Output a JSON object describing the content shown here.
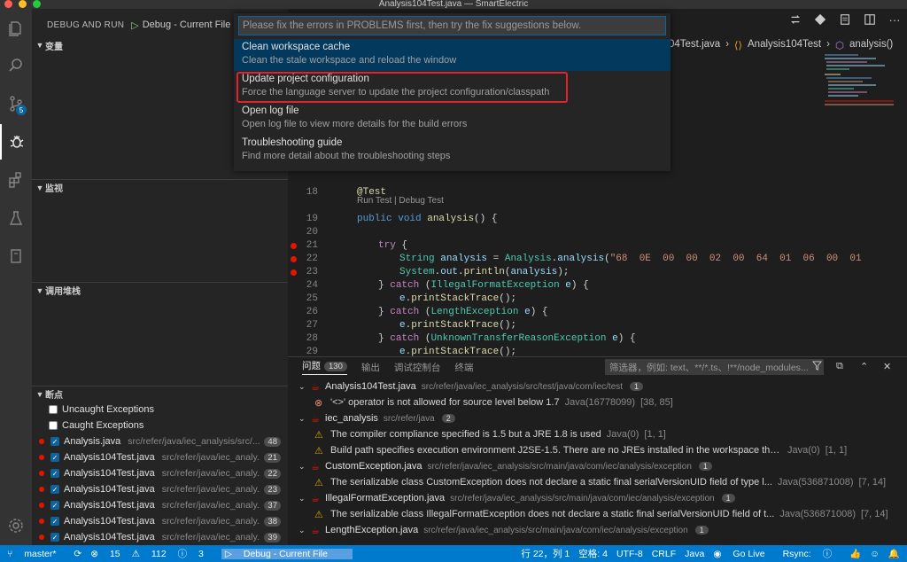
{
  "window_title": "Analysis104Test.java — SmartElectric",
  "sidebar": {
    "title": "DEBUG AND RUN",
    "config": "Debug - Current File",
    "sections": {
      "variables": "变量",
      "watch": "监视",
      "callstack": "调用堆栈",
      "breakpoints": "断点"
    },
    "breakpoints": [
      {
        "name": "Uncaught Exceptions",
        "checked": false
      },
      {
        "name": "Caught Exceptions",
        "checked": false
      },
      {
        "name": "Analysis.java",
        "path": "src/refer/java/iec_analysis/src/...",
        "line": "48"
      },
      {
        "name": "Analysis104Test.java",
        "path": "src/refer/java/iec_analy...",
        "line": "21"
      },
      {
        "name": "Analysis104Test.java",
        "path": "src/refer/java/iec_analy...",
        "line": "22"
      },
      {
        "name": "Analysis104Test.java",
        "path": "src/refer/java/iec_analy...",
        "line": "23"
      },
      {
        "name": "Analysis104Test.java",
        "path": "src/refer/java/iec_analy...",
        "line": "37"
      },
      {
        "name": "Analysis104Test.java",
        "path": "src/refer/java/iec_analy...",
        "line": "38"
      },
      {
        "name": "Analysis104Test.java",
        "path": "src/refer/java/iec_analy...",
        "line": "39"
      }
    ]
  },
  "breadcrumb": [
    "04Test.java",
    "›",
    "Analysis104Test",
    "›",
    "analysis()"
  ],
  "quickpick": {
    "placeholder": "Please fix the errors in PROBLEMS first, then try the fix suggestions below.",
    "items": [
      {
        "label": "Clean workspace cache",
        "detail": "Clean the stale workspace and reload the window"
      },
      {
        "label": "Update project configuration",
        "detail": "Force the language server to update the project configuration/classpath"
      },
      {
        "label": "Open log file",
        "detail": "Open log file to view more details for the build errors"
      },
      {
        "label": "Troubleshooting guide",
        "detail": "Find more detail about the troubleshooting steps"
      }
    ]
  },
  "code": {
    "codelens": "Run Test | Debug Test",
    "lines": [
      {
        "n": "18",
        "text": "@Test"
      },
      {
        "n": "19",
        "text": "public void analysis() {"
      },
      {
        "n": "20",
        "text": ""
      },
      {
        "n": "21",
        "text": "try {",
        "bp": true
      },
      {
        "n": "22",
        "text": "String analysis = Analysis.analysis(\"68  0E  00  00  02  00  64  01  06  00  01",
        "bp": true
      },
      {
        "n": "23",
        "text": "System.out.println(analysis);",
        "bp": true
      },
      {
        "n": "24",
        "text": "} catch (IllegalFormatException e) {"
      },
      {
        "n": "25",
        "text": "e.printStackTrace();"
      },
      {
        "n": "26",
        "text": "} catch (LengthException e) {"
      },
      {
        "n": "27",
        "text": "e.printStackTrace();"
      },
      {
        "n": "28",
        "text": "} catch (UnknownTransferReasonException e) {"
      },
      {
        "n": "29",
        "text": "e.printStackTrace();"
      }
    ]
  },
  "panel": {
    "tabs": {
      "problems": "问题",
      "problems_count": "130",
      "output": "输出",
      "debug_console": "调试控制台",
      "terminal": "终端"
    },
    "filter_placeholder": "筛选器，例如: text、**/*.ts、!**/node_modules...",
    "rows": [
      {
        "kind": "file",
        "file": "Analysis104Test.java",
        "path": "src/refer/java/iec_analysis/src/test/java/com/iec/test",
        "count": "1"
      },
      {
        "kind": "error",
        "msg": "'<>' operator is not allowed for source level below 1.7",
        "src": "Java(16778099)",
        "pos": "[38, 85]"
      },
      {
        "kind": "file",
        "file": "iec_analysis",
        "path": "src/refer/java",
        "count": "2"
      },
      {
        "kind": "warn",
        "msg": "The compiler compliance specified is 1.5 but a JRE 1.8 is used",
        "src": "Java(0)",
        "pos": "[1, 1]"
      },
      {
        "kind": "warn",
        "msg": "Build path specifies execution environment J2SE-1.5. There are no JREs installed in the workspace that are strictl...",
        "src": "Java(0)",
        "pos": "[1, 1]"
      },
      {
        "kind": "file",
        "file": "CustomException.java",
        "path": "src/refer/java/iec_analysis/src/main/java/com/iec/analysis/exception",
        "count": "1"
      },
      {
        "kind": "warn",
        "msg": "The serializable class CustomException does not declare a static final serialVersionUID field of type l...",
        "src": "Java(536871008)",
        "pos": "[7, 14]"
      },
      {
        "kind": "file",
        "file": "IllegalFormatException.java",
        "path": "src/refer/java/iec_analysis/src/main/java/com/iec/analysis/exception",
        "count": "1"
      },
      {
        "kind": "warn",
        "msg": "The serializable class IllegalFormatException does not declare a static final serialVersionUID field of t...",
        "src": "Java(536871008)",
        "pos": "[7, 14]"
      },
      {
        "kind": "file",
        "file": "LengthException.java",
        "path": "src/refer/java/iec_analysis/src/main/java/com/iec/analysis/exception",
        "count": "1"
      }
    ]
  },
  "status": {
    "branch": "master*",
    "errors": "15",
    "warnings": "112",
    "info": "3",
    "debug": "Debug - Current File",
    "position": "行 22，列 1",
    "spaces": "空格: 4",
    "encoding": "UTF-8",
    "eol": "CRLF",
    "language": "Java",
    "golive": "Go Live",
    "rsync": "Rsync:"
  },
  "colors": {
    "accent": "#007acc",
    "highlight": "#e0242e",
    "selection": "#04395e"
  }
}
